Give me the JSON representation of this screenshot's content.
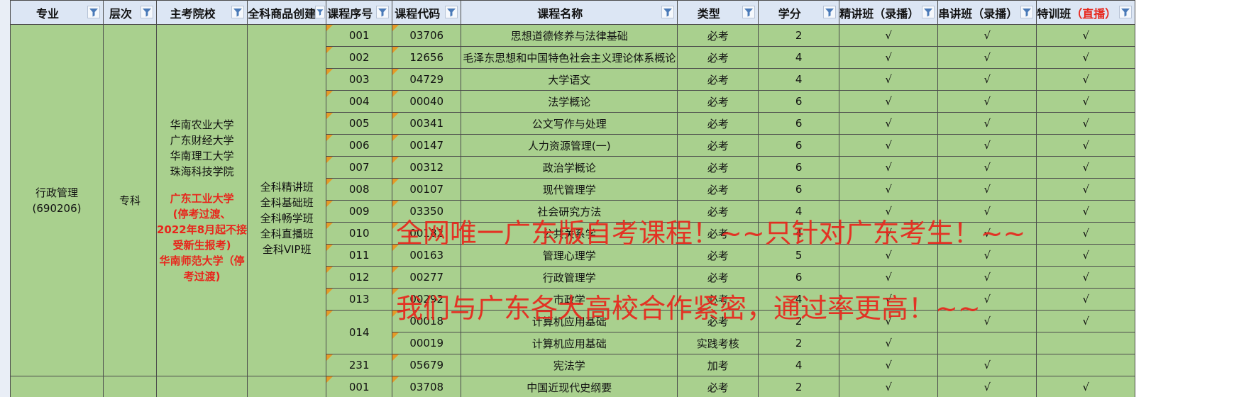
{
  "headers": {
    "major": "专业",
    "level": "层次",
    "school": "主考院校",
    "create": "全科商品创建",
    "seq": "课程序号",
    "code": "课程代码",
    "name": "课程名称",
    "type": "类型",
    "credit": "学分",
    "jingjiang": "精讲班（录播）",
    "chuanjiang": "串讲班（录播）",
    "texun_prefix": "特训班",
    "texun_suffix": "（直播）"
  },
  "group": {
    "major_name": "行政管理",
    "major_code": "(690206)",
    "level": "专科",
    "schools": [
      "华南农业大学",
      "广东财经大学",
      "华南理工大学",
      "珠海科技学院"
    ],
    "schools_red": [
      "广东工业大学",
      "(停考过渡、",
      "2022年8月起不接",
      "受新生报考)",
      "华南师范大学（停",
      "考过渡)"
    ],
    "classes": [
      "全科精讲班",
      "全科基础班",
      "全科畅学班",
      "全科直播班",
      "全科VIP班"
    ]
  },
  "check": "√",
  "rows": [
    {
      "seq": "001",
      "code": "03706",
      "name": "思想道德修养与法律基础",
      "type": "必考",
      "credit": "2",
      "j": "√",
      "c": "√",
      "t": "√"
    },
    {
      "seq": "002",
      "code": "12656",
      "name": "毛泽东思想和中国特色社会主义理论体系概论",
      "type": "必考",
      "credit": "4",
      "j": "√",
      "c": "√",
      "t": "√"
    },
    {
      "seq": "003",
      "code": "04729",
      "name": "大学语文",
      "type": "必考",
      "credit": "4",
      "j": "√",
      "c": "√",
      "t": "√"
    },
    {
      "seq": "004",
      "code": "00040",
      "name": "法学概论",
      "type": "必考",
      "credit": "6",
      "j": "√",
      "c": "√",
      "t": "√"
    },
    {
      "seq": "005",
      "code": "00341",
      "name": "公文写作与处理",
      "type": "必考",
      "credit": "6",
      "j": "√",
      "c": "√",
      "t": "√"
    },
    {
      "seq": "006",
      "code": "00147",
      "name": "人力资源管理(一)",
      "type": "必考",
      "credit": "6",
      "j": "√",
      "c": "√",
      "t": "√"
    },
    {
      "seq": "007",
      "code": "00312",
      "name": "政治学概论",
      "type": "必考",
      "credit": "6",
      "j": "√",
      "c": "√",
      "t": "√"
    },
    {
      "seq": "008",
      "code": "00107",
      "name": "现代管理学",
      "type": "必考",
      "credit": "6",
      "j": "√",
      "c": "√",
      "t": "√"
    },
    {
      "seq": "009",
      "code": "03350",
      "name": "社会研究方法",
      "type": "必考",
      "credit": "4",
      "j": "√",
      "c": "√",
      "t": "√"
    },
    {
      "seq": "010",
      "code": "00182",
      "name": "公共关系学",
      "type": "必考",
      "credit": "4",
      "j": "√",
      "c": "√",
      "t": "√"
    },
    {
      "seq": "011",
      "code": "00163",
      "name": "管理心理学",
      "type": "必考",
      "credit": "5",
      "j": "√",
      "c": "√",
      "t": "√"
    },
    {
      "seq": "012",
      "code": "00277",
      "name": "行政管理学",
      "type": "必考",
      "credit": "6",
      "j": "√",
      "c": "√",
      "t": "√"
    },
    {
      "seq": "013",
      "code": "00292",
      "name": "市政学",
      "type": "必考",
      "credit": "4",
      "j": "√",
      "c": "√",
      "t": "√"
    },
    {
      "seq": "014",
      "code": "00018",
      "name": "计算机应用基础",
      "type": "必考",
      "credit": "2",
      "j": "√",
      "c": "√",
      "t": "√"
    },
    {
      "seq": "",
      "code": "00019",
      "name": "计算机应用基础",
      "type": "实践考核",
      "credit": "2",
      "j": "√",
      "c": "",
      "t": ""
    },
    {
      "seq": "231",
      "code": "05679",
      "name": "宪法学",
      "type": "加考",
      "credit": "4",
      "j": "√",
      "c": "√",
      "t": ""
    }
  ],
  "next_row": {
    "seq": "001",
    "code": "03708",
    "name": "中国近现代史纲要",
    "type": "必考",
    "credit": "2",
    "j": "√",
    "c": "√",
    "t": "√"
  },
  "overlay": {
    "line1": "全网唯一广东版自考课程！~~只针对广东考生！~~",
    "line2": "我们与广东各大高校合作紧密，通过率更高！~~"
  },
  "colors": {
    "cell_green": "#a9d08e",
    "header_blue": "#dce6f4",
    "red": "#e8261c",
    "comment_marker": "#e59b27"
  }
}
